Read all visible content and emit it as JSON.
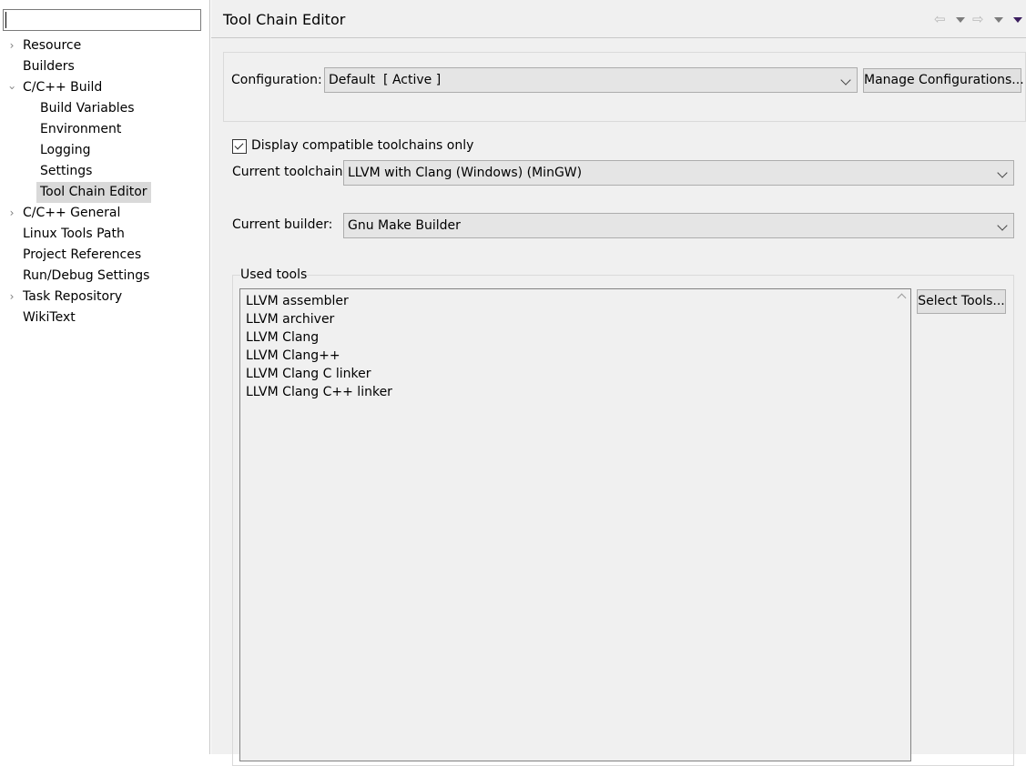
{
  "left_tree": {
    "filter": {
      "value": "",
      "placeholder": ""
    },
    "items": [
      {
        "label": "Resource",
        "expander": "collapsed",
        "level": 0
      },
      {
        "label": "Builders",
        "expander": "none",
        "level": 0
      },
      {
        "label": "C/C++ Build",
        "expander": "expanded",
        "level": 0
      },
      {
        "label": "Build Variables",
        "expander": "none",
        "level": 1
      },
      {
        "label": "Environment",
        "expander": "none",
        "level": 1
      },
      {
        "label": "Logging",
        "expander": "none",
        "level": 1
      },
      {
        "label": "Settings",
        "expander": "none",
        "level": 1
      },
      {
        "label": "Tool Chain Editor",
        "expander": "none",
        "level": 1,
        "selected": true
      },
      {
        "label": "C/C++ General",
        "expander": "collapsed",
        "level": 0
      },
      {
        "label": "Linux Tools Path",
        "expander": "none",
        "level": 0
      },
      {
        "label": "Project References",
        "expander": "none",
        "level": 0
      },
      {
        "label": "Run/Debug Settings",
        "expander": "none",
        "level": 0
      },
      {
        "label": "Task Repository",
        "expander": "collapsed",
        "level": 0
      },
      {
        "label": "WikiText",
        "expander": "none",
        "level": 0
      }
    ]
  },
  "header": {
    "title": "Tool Chain Editor",
    "nav_icons": [
      "back-arrow-icon",
      "back-menu-icon",
      "forward-arrow-icon",
      "forward-menu-icon",
      "view-menu-icon"
    ]
  },
  "configuration": {
    "label": "Configuration:",
    "selected": "Default  [ Active ]",
    "manage_button": "Manage Configurations..."
  },
  "options": {
    "compatible_only_label": "Display compatible toolchains only",
    "compatible_only_checked": true,
    "toolchain_label": "Current toolchain:",
    "toolchain_value": "LLVM with Clang (Windows) (MinGW)",
    "builder_label": "Current builder:",
    "builder_value": "Gnu Make Builder"
  },
  "used_tools": {
    "group_label": "Used tools",
    "items": [
      "LLVM assembler",
      "LLVM archiver",
      "LLVM Clang",
      "LLVM Clang++",
      "LLVM Clang C linker",
      "LLVM Clang C++ linker"
    ],
    "select_button": "Select Tools..."
  },
  "colors": {
    "panel_bg": "#f0f0f0",
    "selection_bg": "#d9d9d9",
    "nav_menu_accent": "#3b1e5f"
  }
}
